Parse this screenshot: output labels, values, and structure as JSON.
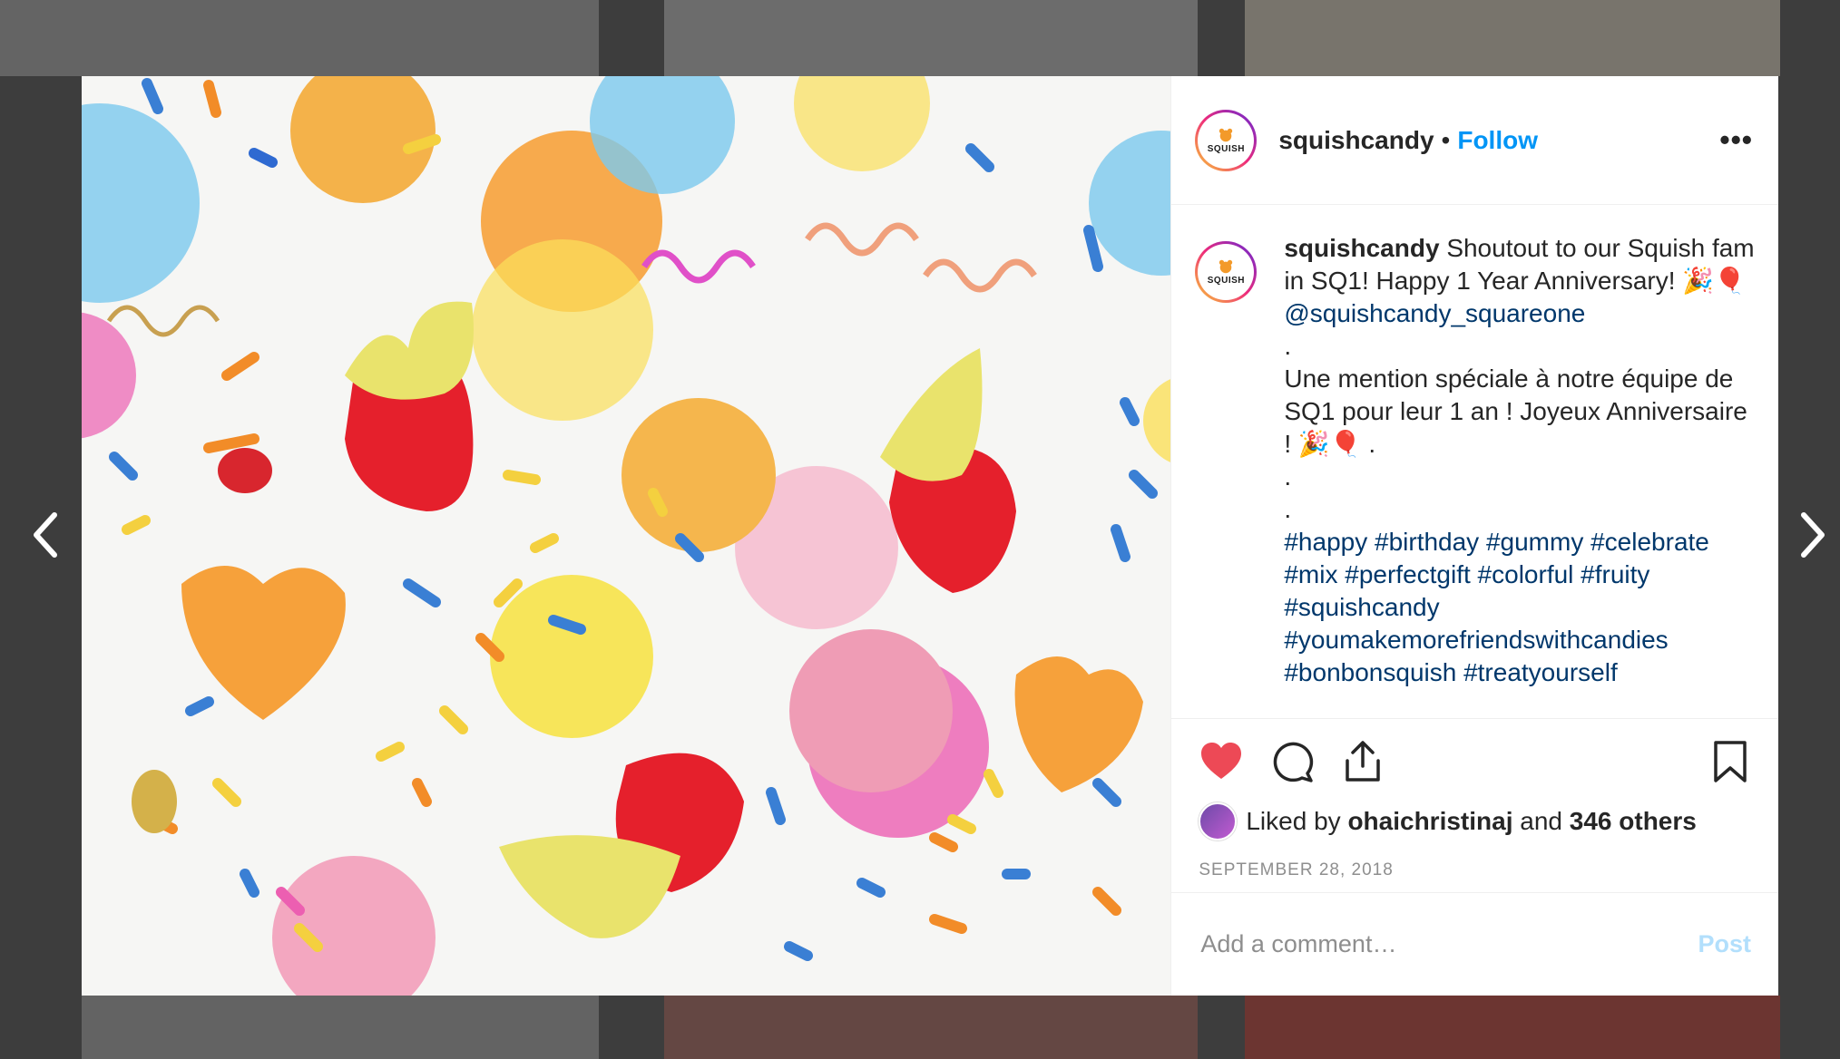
{
  "post": {
    "username": "squishcandy",
    "separator": "•",
    "follow_label": "Follow",
    "more_label": "•••",
    "avatar_text": "SQUISH",
    "caption": {
      "username": "squishcandy",
      "lines": [
        "Shoutout to our Squish fam in SQ1! Happy 1 Year Anniversary! 🎉🎈 ",
        ".",
        "Une mention spéciale à notre équipe de SQ1 pour leur 1 an ! Joyeux Anniversaire ! 🎉🎈 .",
        ".",
        "."
      ],
      "mention": "@squishcandy_squareone",
      "hashtags": "#happy #birthday #gummy #celebrate #mix #perfectgift #colorful #fruity #squishcandy #youmakemorefriendswithcandies #bonbonsquish #treatyourself"
    },
    "likes": {
      "prefix": "Liked by",
      "user": "ohaichristinaj",
      "connector": "and",
      "others": "346 others"
    },
    "date": "SEPTEMBER 28, 2018",
    "comment": {
      "placeholder": "Add a comment…",
      "post_label": "Post"
    },
    "colors": {
      "follow": "#0095f6",
      "like_heart": "#ed4956",
      "post_disabled": "#b2dffc",
      "link": "#00376b"
    }
  },
  "icons": {
    "prev": "chevron-left-icon",
    "next": "chevron-right-icon",
    "like": "heart-icon",
    "comment": "comment-icon",
    "share": "share-icon",
    "save": "bookmark-icon"
  }
}
